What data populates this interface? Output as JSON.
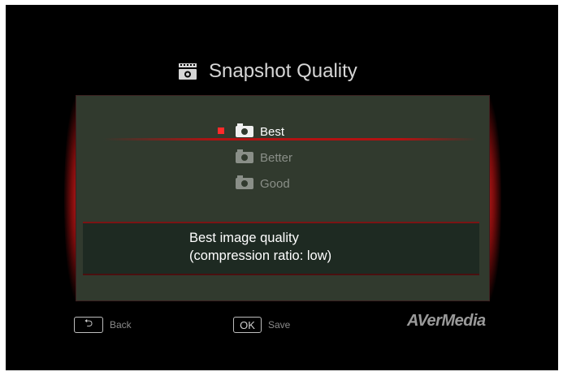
{
  "header": {
    "title": "Snapshot Quality",
    "icon": "snapshot-icon"
  },
  "menu": {
    "items": [
      {
        "label": "Best",
        "icon": "camera-icon",
        "selected": true
      },
      {
        "label": "Better",
        "icon": "camera-icon",
        "selected": false
      },
      {
        "label": "Good",
        "icon": "camera-icon",
        "selected": false
      }
    ]
  },
  "description": {
    "line1": "Best image quality",
    "line2": "(compression ratio: low)"
  },
  "footer": {
    "back_key": "⮌",
    "back_label": "Back",
    "ok_key": "OK",
    "save_label": "Save",
    "brand": "AVerMedia"
  },
  "colors": {
    "accent": "#d21f1f",
    "panel": "#313a2e",
    "selected_dot": "#ff2a2a"
  }
}
